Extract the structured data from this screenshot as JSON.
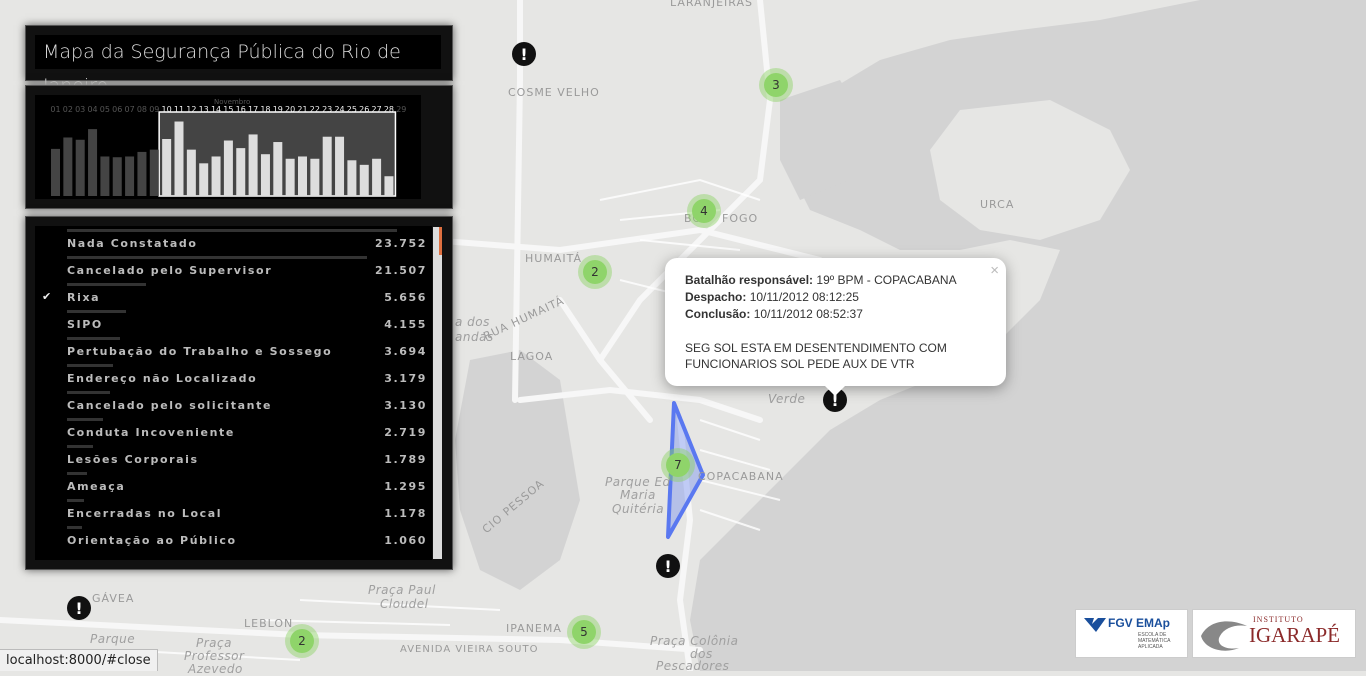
{
  "app": {
    "title": "Mapa da Segurança Pública do Rio de Janeiro"
  },
  "map": {
    "labels": {
      "laranjeiras": "LARANJEIRAS",
      "cosme_velho": "COSME VELHO",
      "urca": "URCA",
      "botafogo_a": "BO",
      "botafogo_b": "FOGO",
      "humaita": "HUMAITÁ",
      "lagoa": "LAGOA",
      "copacabana": "COPACABANA",
      "gavea": "GÁVEA",
      "leblon": "LEBLON",
      "ipanema": "IPANEMA",
      "lagoa_dos": "a dos",
      "lagoa_frandas": "andas",
      "verde": "Verde",
      "parque_maria": "Parque Ed",
      "parque_maria2": "Maria",
      "parque_maria3": "Quitéria",
      "praca_paul": "Praça Paul",
      "praca_paul2": "Cloudel",
      "praca_prof": "Praça",
      "praca_prof2": "Professor",
      "praca_prof3": "Azevedo",
      "parque": "Parque",
      "praca_colonia": "Praça Colônia",
      "praca_colonia2": "dos",
      "praca_colonia3": "Pescadores",
      "av_vieira": "AVENIDA VIEIRA SOUTO",
      "av_pessoa": "CIO PESSOA",
      "rua_humaita": "RUA HUMAITÁ"
    },
    "clusters": [
      {
        "count": "3"
      },
      {
        "count": "4"
      },
      {
        "count": "2"
      },
      {
        "count": "7"
      },
      {
        "count": "2"
      },
      {
        "count": "5"
      }
    ],
    "alert_glyph": "!"
  },
  "histogram": {
    "month_label": "Novembro",
    "days": [
      "01",
      "02",
      "03",
      "04",
      "05",
      "06",
      "07",
      "08",
      "09",
      "10",
      "11",
      "12",
      "13",
      "14",
      "15",
      "16",
      "17",
      "18",
      "19",
      "20",
      "21",
      "22",
      "23",
      "24",
      "25",
      "26",
      "27",
      "28",
      "29"
    ],
    "values": [
      0.62,
      0.77,
      0.74,
      0.88,
      0.52,
      0.51,
      0.52,
      0.58,
      0.61,
      0.75,
      0.98,
      0.61,
      0.43,
      0.52,
      0.73,
      0.63,
      0.81,
      0.55,
      0.71,
      0.49,
      0.52,
      0.49,
      0.78,
      0.78,
      0.47,
      0.41,
      0.49,
      0.26,
      0.0
    ],
    "selected_range": [
      "10",
      "28"
    ]
  },
  "categories": {
    "items": [
      {
        "label": "Nada Constatado",
        "value": "23.752",
        "checked": false,
        "bar": 1.0
      },
      {
        "label": "Cancelado pelo Supervisor",
        "value": "21.507",
        "checked": false,
        "bar": 0.91
      },
      {
        "label": "Rixa",
        "value": "5.656",
        "checked": true,
        "bar": 0.24
      },
      {
        "label": "SIPO",
        "value": "4.155",
        "checked": false,
        "bar": 0.18
      },
      {
        "label": "Pertubação do Trabalho e Sossego",
        "value": "3.694",
        "checked": false,
        "bar": 0.16
      },
      {
        "label": "Endereço não Localizado",
        "value": "3.179",
        "checked": false,
        "bar": 0.14
      },
      {
        "label": "Cancelado pelo solicitante",
        "value": "3.130",
        "checked": false,
        "bar": 0.13
      },
      {
        "label": "Conduta Incoveniente",
        "value": "2.719",
        "checked": false,
        "bar": 0.11
      },
      {
        "label": "Lesões Corporais",
        "value": "1.789",
        "checked": false,
        "bar": 0.08
      },
      {
        "label": "Ameaça",
        "value": "1.295",
        "checked": false,
        "bar": 0.06
      },
      {
        "label": "Encerradas no Local",
        "value": "1.178",
        "checked": false,
        "bar": 0.05
      },
      {
        "label": "Orientação ao Público",
        "value": "1.060",
        "checked": false,
        "bar": 0.045
      }
    ],
    "check_glyph": "✔"
  },
  "popup": {
    "close_glyph": "×",
    "battalion_label": "Batalhão responsável:",
    "battalion_value": "19º BPM - COPACABANA",
    "dispatch_label": "Despacho:",
    "dispatch_value": "10/11/2012 08:12:25",
    "conclusion_label": "Conclusão:",
    "conclusion_value": "10/11/2012 08:52:37",
    "description_line1": "SEG SOL ESTA EM DESENTENDIMENTO COM",
    "description_line2": "FUNCIONARIOS SOL PEDE AUX DE VTR"
  },
  "logos": {
    "fgv_main": "FGV EMAp",
    "fgv_sub1": "ESCOLA DE",
    "fgv_sub2": "MATEMÁTICA",
    "fgv_sub3": "APLICADA",
    "igarape_top": "INSTITUTO",
    "igarape_main": "IGARAPÉ"
  },
  "status_bar": {
    "url": "localhost:8000/#close"
  },
  "colors": {
    "cluster_green": "#8fd46a",
    "polygon_blue": "#5a78f0",
    "scroll_accent": "#e07040"
  }
}
